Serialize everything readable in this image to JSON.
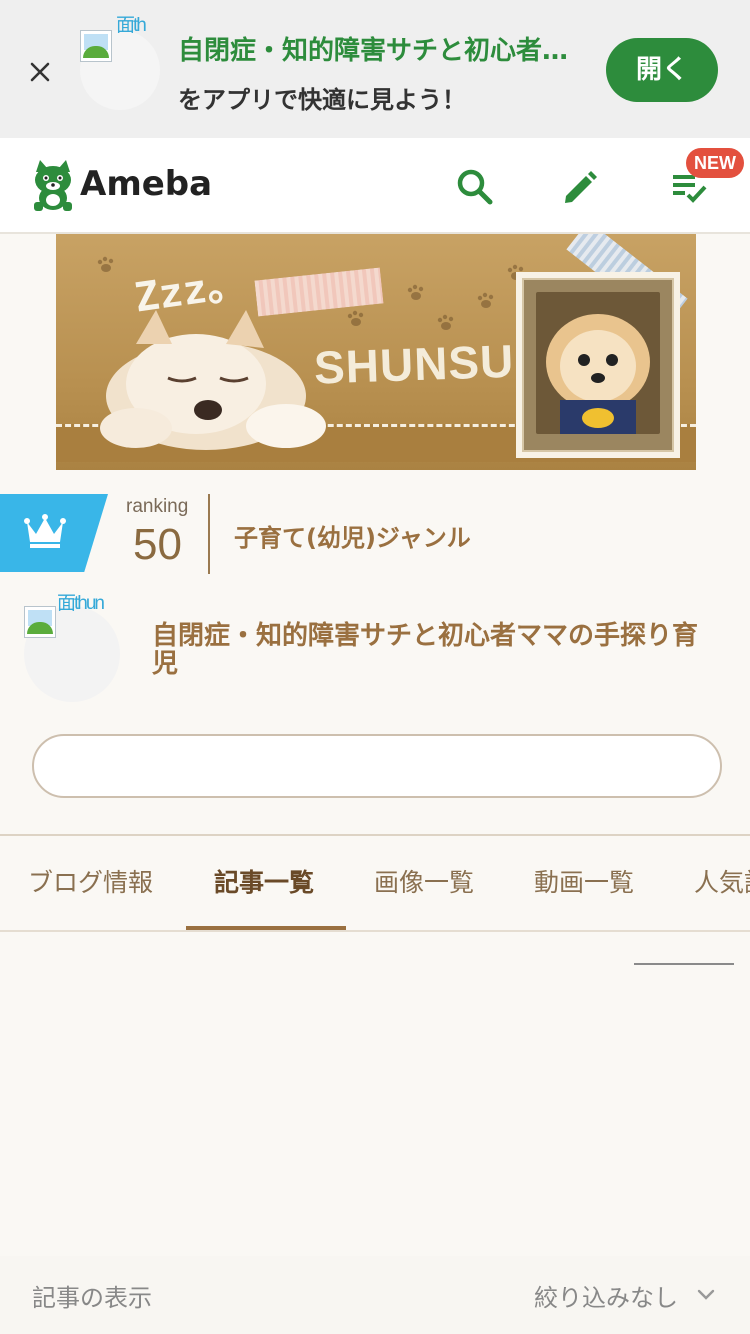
{
  "promo": {
    "avatar_alt": "面th",
    "title": "自閉症・知的障害サチと初心者ママの手探り育児",
    "subtitle": "をアプリで快適に見よう！",
    "open_label": "開く"
  },
  "header": {
    "logo_text": "Ameba",
    "new_badge": "NEW"
  },
  "cover": {
    "title_text": "SHUNSUKE",
    "zzz": "Zzz。"
  },
  "ranking": {
    "label": "ranking",
    "number": "50",
    "genre": "子育て(幼児)ジャンル"
  },
  "blog": {
    "avatar_alt": "面thun",
    "title": "自閉症・知的障害サチと初心者ママの手探り育児"
  },
  "search": {
    "placeholder": ""
  },
  "tabs": [
    {
      "label": "ブログ情報"
    },
    {
      "label": "記事一覧"
    },
    {
      "label": "画像一覧"
    },
    {
      "label": "動画一覧"
    },
    {
      "label": "人気記事"
    }
  ],
  "active_tab": "記事一覧",
  "filter": {
    "label": "記事の表示",
    "value": "絞り込みなし"
  },
  "colors": {
    "ameba_green": "#2d8c3c",
    "badge_red": "#e3503e",
    "ranking_blue": "#39b6e8",
    "brown_text": "#9a7040"
  }
}
